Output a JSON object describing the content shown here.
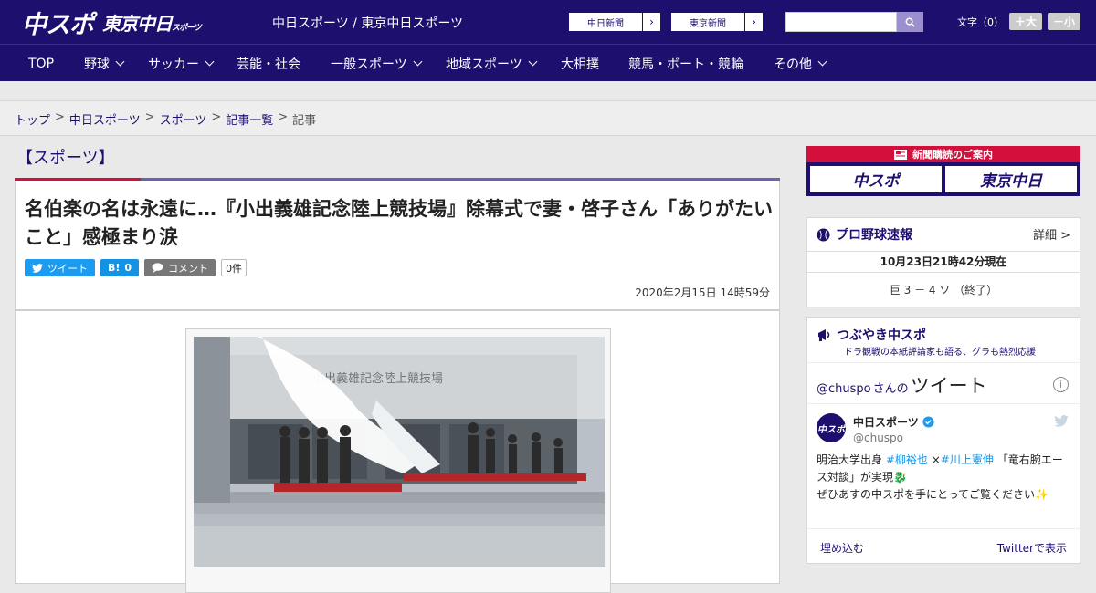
{
  "header": {
    "logo_chuspo": "中スポ",
    "logo_tokyo": "東京中日",
    "logo_tokyo_small": "スポーツ",
    "site_names": "中日スポーツ / 東京中日スポーツ",
    "paper_buttons": [
      "中日新聞",
      "東京新聞"
    ],
    "search_placeholder": "",
    "font_size_label": "文字（0）",
    "font_plus": "＋大",
    "font_minus": "－小"
  },
  "nav": {
    "items": [
      "TOP",
      "野球",
      "サッカー",
      "芸能・社会",
      "一般スポーツ",
      "地域スポーツ",
      "大相撲",
      "競馬・ボート・競輪",
      "その他"
    ]
  },
  "breadcrumb": {
    "items": [
      "トップ",
      "中日スポーツ",
      "スポーツ",
      "記事一覧"
    ],
    "current": "記事",
    "separator": ">"
  },
  "section_label": "【スポーツ】",
  "article": {
    "headline": "名伯楽の名は永遠に…『小出義雄記念陸上競技場』除幕式で妻・啓子さん「ありがたいこと」感極まり涙",
    "share": {
      "tweet": "ツイート",
      "hatena": "B!",
      "hatena_count": "0",
      "comment": "コメント",
      "comment_count": "0件"
    },
    "date": "2020年2月15日 14時59分",
    "photo_sign": "小出義雄記念陸上競技場"
  },
  "sidebar": {
    "promo_title": "新聞購読のご案内",
    "promo_logos": [
      "中スポ",
      "東京中日"
    ],
    "baseball": {
      "title": "プロ野球速報",
      "detail": "詳細 >",
      "time": "10月23日21時42分現在",
      "score": "巨 3 － 4 ソ （終了）"
    },
    "tweets": {
      "title": "つぶやき中スポ",
      "subtitle": "ドラ観戦の本紙評論家も語る、グラも熱烈応援",
      "by_handle": "@chuspo",
      "by_san": "さんの",
      "by_label": "ツイート",
      "info": "i",
      "account_name": "中日スポーツ",
      "account_handle": "@chuspo",
      "avatar_text": "中スポ",
      "text_1": "明治大学出身",
      "tag_1": "#柳裕也",
      "text_2": "×",
      "tag_2": "#川上憲伸",
      "text_3": "「竜右腕エース対談」が実現🐉",
      "text_4": "ぜひあすの中スポを手にとってご覧ください✨",
      "embed": "埋め込む",
      "view_on_twitter": "Twitterで表示"
    }
  },
  "colors": {
    "brand_navy": "#1c0f6e",
    "accent_red": "#d3103c",
    "twitter_blue": "#1d9bf0",
    "hatena_blue": "#1592e2",
    "comment_gray": "#777777"
  }
}
